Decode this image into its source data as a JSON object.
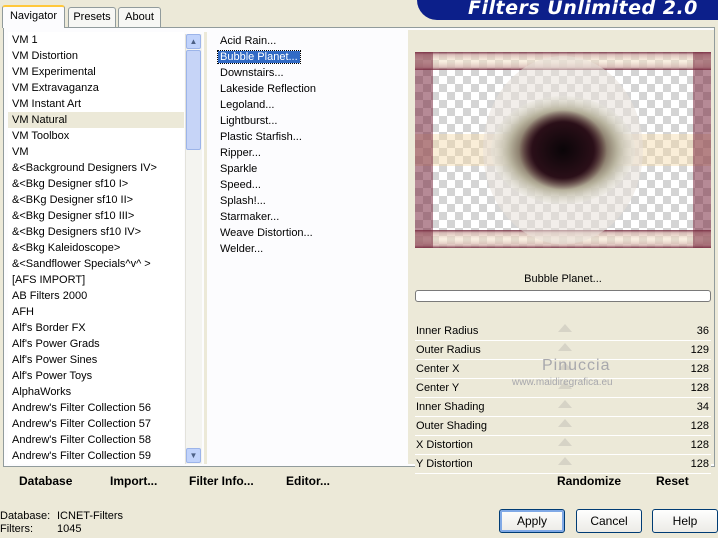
{
  "app": {
    "title": "Filters Unlimited 2.0"
  },
  "tabs": [
    {
      "label": "Navigator",
      "active": true
    },
    {
      "label": "Presets",
      "active": false
    },
    {
      "label": "About",
      "active": false
    }
  ],
  "categories": [
    "VM 1",
    "VM Distortion",
    "VM Experimental",
    "VM Extravaganza",
    "VM Instant Art",
    "VM Natural",
    "VM Toolbox",
    "VM",
    "&<Background Designers IV>",
    "&<Bkg Designer sf10 I>",
    "&<BKg Designer sf10 II>",
    "&<Bkg Designer sf10 III>",
    "&<Bkg Designers sf10 IV>",
    "&<Bkg Kaleidoscope>",
    "&<Sandflower Specials^v^ >",
    "[AFS IMPORT]",
    "AB Filters 2000",
    "AFH",
    "Alf's Border FX",
    "Alf's Power Grads",
    "Alf's Power Sines",
    "Alf's Power Toys",
    "AlphaWorks",
    "Andrew's Filter Collection 56",
    "Andrew's Filter Collection 57",
    "Andrew's Filter Collection 58",
    "Andrew's Filter Collection 59"
  ],
  "selected_category": "VM Natural",
  "filters": [
    "Acid Rain...",
    "Bubble Planet...",
    "Downstairs...",
    "Lakeside Reflection",
    "Legoland...",
    "Lightburst...",
    "Plastic Starfish...",
    "Ripper...",
    "Sparkle",
    "Speed...",
    "Splash!...",
    "Starmaker...",
    "Weave Distortion...",
    "Welder..."
  ],
  "selected_filter": "Bubble Planet...",
  "preview": {
    "filter_name": "Bubble Planet..."
  },
  "params": [
    {
      "label": "Inner Radius",
      "value": "36"
    },
    {
      "label": "Outer Radius",
      "value": "129"
    },
    {
      "label": "Center X",
      "value": "128"
    },
    {
      "label": "Center Y",
      "value": "128"
    },
    {
      "label": "Inner Shading",
      "value": "34"
    },
    {
      "label": "Outer Shading",
      "value": "128"
    },
    {
      "label": "X Distortion",
      "value": "128"
    },
    {
      "label": "Y Distortion",
      "value": "128"
    }
  ],
  "watermark": {
    "line1": "Pinuccia",
    "line2": "www.maidiregrafica.eu"
  },
  "actions": {
    "database": "Database",
    "import": "Import...",
    "filter_info": "Filter Info...",
    "editor": "Editor...",
    "randomize": "Randomize",
    "reset": "Reset"
  },
  "status": {
    "database_label": "Database:",
    "database_value": "ICNET-Filters",
    "filters_label": "Filters:",
    "filters_value": "1045"
  },
  "buttons": {
    "apply": "Apply",
    "cancel": "Cancel",
    "help": "Help"
  },
  "colors": {
    "banner": "#0c1f8a",
    "selection": "#316ac5",
    "tab_highlight": "#ffc83c"
  }
}
